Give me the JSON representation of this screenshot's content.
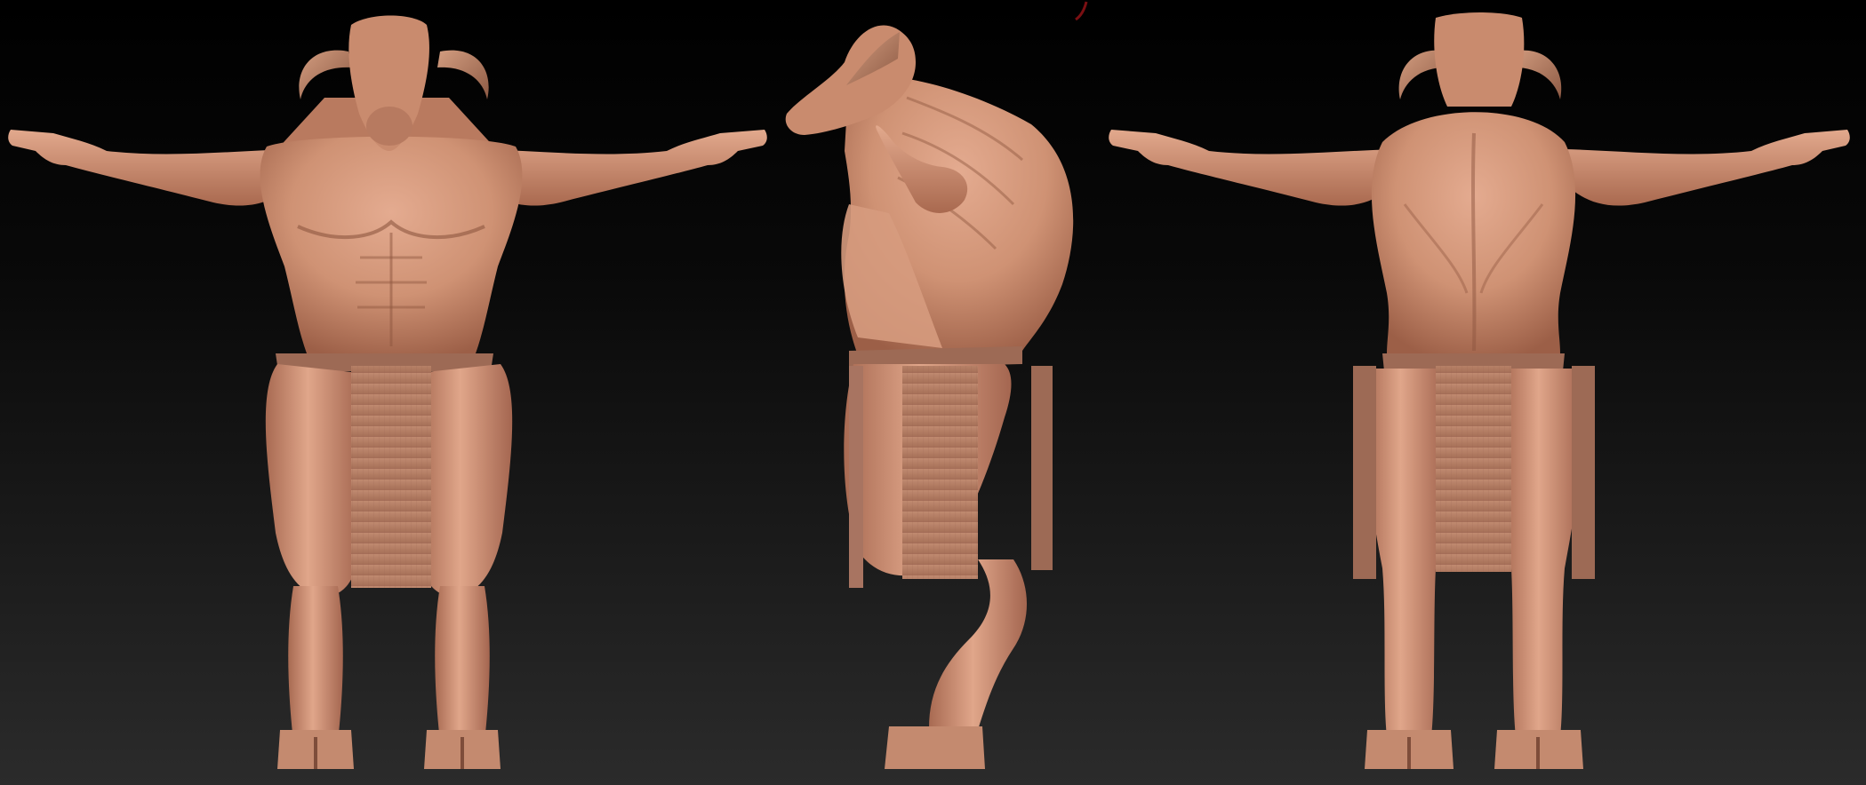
{
  "scene": {
    "kind": "3d-sculpt-turnaround",
    "subject": "minotaur-figure",
    "colors": {
      "background_top": "#000000",
      "background_bottom": "#2b2b2b",
      "skin_light": "#dfa489",
      "skin_mid": "#c9896c",
      "skin_shadow": "#8a543f",
      "skin_deep_shadow": "#5e3527",
      "horn": "#c08a6d",
      "loincloth": "#b9826a",
      "loincloth_shadow": "#7e4f3d",
      "stray_stroke": "#7a0f12"
    },
    "views": [
      "front",
      "side",
      "back"
    ]
  }
}
